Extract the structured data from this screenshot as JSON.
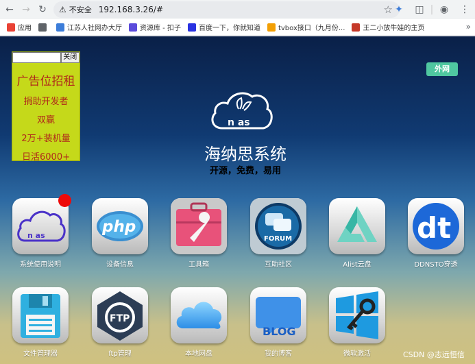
{
  "browser": {
    "security_label": "不安全",
    "url": "192.168.3.26/#",
    "bookmarks": [
      {
        "label": "应用",
        "icon": "apps-grid-icon",
        "color": "#e94235"
      },
      {
        "label": "",
        "icon": "grid-icon",
        "color": "#5f6368"
      },
      {
        "label": "江苏人社网办大厅",
        "icon": "site-icon",
        "color": "#3c7dd9"
      },
      {
        "label": "资源库 - 扣子",
        "icon": "site-icon",
        "color": "#5b4bdb"
      },
      {
        "label": "百度一下，你就知道",
        "icon": "baidu-icon",
        "color": "#2932e1"
      },
      {
        "label": "tvbox接口（九月份...",
        "icon": "flower-icon",
        "color": "#f29f05"
      },
      {
        "label": "王二小放牛娃的主页",
        "icon": "site-icon",
        "color": "#c53929"
      }
    ]
  },
  "ad": {
    "close_label": "关闭",
    "title": "广告位招租",
    "lines": [
      "捐助开发者",
      "双赢",
      "2万+装机量",
      "日活6000+"
    ]
  },
  "outnet_button": "外网",
  "header": {
    "logo_text": "n as",
    "title": "海纳思系统",
    "subtitle": "开源，免费，易用"
  },
  "apps": [
    {
      "label": "系统使用说明",
      "icon": "nas-logo-icon"
    },
    {
      "label": "设备信息",
      "icon": "php-icon"
    },
    {
      "label": "工具箱",
      "icon": "toolbox-icon"
    },
    {
      "label": "互助社区",
      "icon": "forum-icon"
    },
    {
      "label": "Alist云盘",
      "icon": "alist-icon"
    },
    {
      "label": "DDNSTO穿透",
      "icon": "ddnsto-icon"
    },
    {
      "label": "文件管理器",
      "icon": "floppy-disk-icon"
    },
    {
      "label": "ftp管理",
      "icon": "ftp-icon"
    },
    {
      "label": "本地网盘",
      "icon": "cloud-icon"
    },
    {
      "label": "我的博客",
      "icon": "blog-icon"
    },
    {
      "label": "微软激活",
      "icon": "windows-key-icon"
    }
  ],
  "icon_text": {
    "php": "php",
    "forum": "FORUM",
    "ftp": "FTP",
    "blog": "BLOG",
    "ddnsto": "dt"
  },
  "watermark": "CSDN @志远恒信"
}
